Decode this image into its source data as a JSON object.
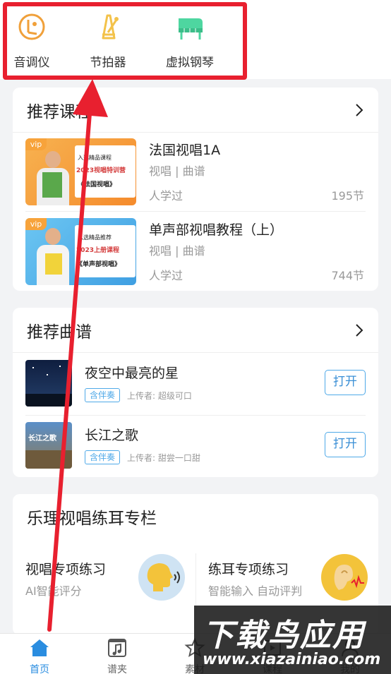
{
  "tools": [
    {
      "label": "音调仪",
      "icon": "tuner-icon"
    },
    {
      "label": "节拍器",
      "icon": "metronome-icon"
    },
    {
      "label": "虚拟钢琴",
      "icon": "piano-icon"
    }
  ],
  "courses": {
    "title": "推荐课程",
    "items": [
      {
        "title": "法国视唱1A",
        "subtitle": "视唱 | 曲谱",
        "learners": "人学过",
        "count": "195节",
        "badge": "vip",
        "thumb_line1": "入选精品课程",
        "thumb_line2": "2023视唱特训营",
        "thumb_line3": "《法国视唱》"
      },
      {
        "title": "单声部视唱教程（上）",
        "subtitle": "视唱 | 曲谱",
        "learners": "人学过",
        "count": "744节",
        "badge": "vip",
        "thumb_line1": "入选精品推荐",
        "thumb_line2": "2023上册课程",
        "thumb_line3": "《单声部视唱》"
      }
    ]
  },
  "scores": {
    "title": "推荐曲谱",
    "items": [
      {
        "title": "夜空中最亮的星",
        "tag": "含伴奏",
        "uploader": "上传者: 超级可口",
        "button": "打开"
      },
      {
        "title": "长江之歌",
        "tag": "含伴奏",
        "uploader": "上传者: 甜尝一口甜",
        "button": "打开",
        "thumb_text": "长江之歌"
      }
    ]
  },
  "practice": {
    "title": "乐理视唱练耳专栏",
    "items": [
      {
        "title": "视唱专项练习",
        "subtitle": "AI智能评分",
        "icon": "singing-head-icon"
      },
      {
        "title": "练耳专项练习",
        "subtitle": "智能输入 自动评判",
        "icon": "ear-icon"
      }
    ]
  },
  "nav": [
    {
      "label": "首页",
      "icon": "home-icon",
      "active": true
    },
    {
      "label": "谱夹",
      "icon": "score-folder-icon",
      "active": false
    },
    {
      "label": "素材",
      "icon": "star-icon",
      "active": false
    },
    {
      "label": "课程",
      "icon": "course-icon",
      "active": false
    },
    {
      "label": "我的",
      "icon": "profile-icon",
      "active": false
    }
  ],
  "watermark": {
    "line1": "下载鸟应用",
    "line2": "www.xiazainiao.com"
  },
  "colors": {
    "accent": "#2a8de0",
    "highlight": "#e8202f",
    "vip": "#f7a33b",
    "tool_orange": "#f0a03a",
    "tool_yellow": "#f3c24a",
    "tool_green": "#4ed6a0"
  }
}
